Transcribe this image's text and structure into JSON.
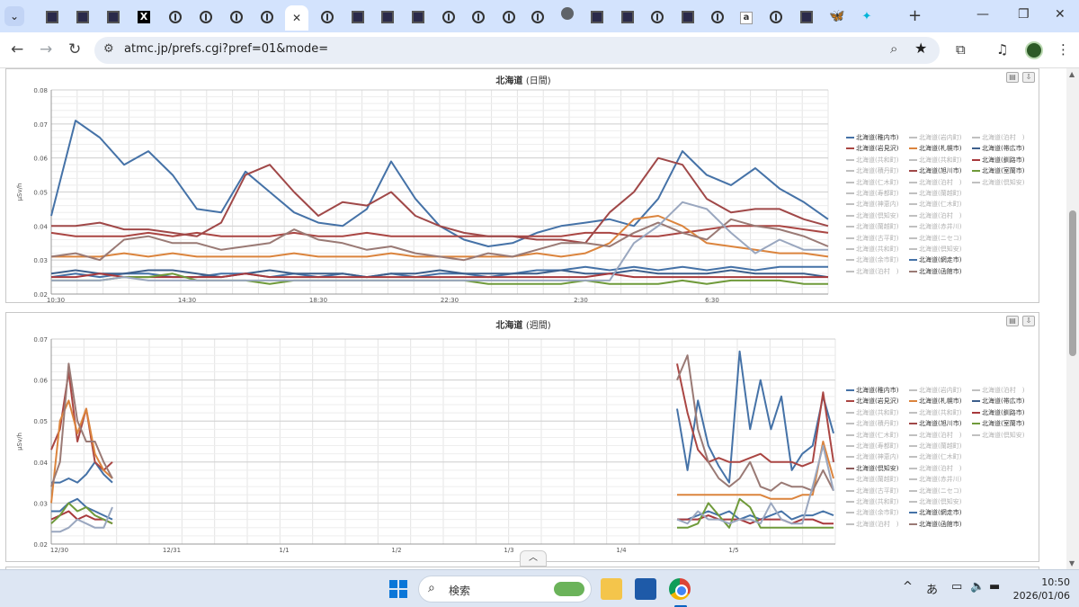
{
  "browser": {
    "url": "atmc.jp/prefs.cgi?pref=01&mode=",
    "tabs_dropdown_icon": "chevron-down-icon",
    "tabs": [
      {
        "icon": "square-site-icon"
      },
      {
        "icon": "square-site-icon"
      },
      {
        "icon": "square-site-icon"
      },
      {
        "icon": "x-icon"
      },
      {
        "icon": "ring-site-icon"
      },
      {
        "icon": "ring-site-icon"
      },
      {
        "icon": "ring-site-icon"
      },
      {
        "icon": "ring-site-icon"
      },
      {
        "icon": "close-icon",
        "active": true
      },
      {
        "icon": "ring-site-icon"
      },
      {
        "icon": "square-site-icon"
      },
      {
        "icon": "square-site-icon"
      },
      {
        "icon": "square-site-icon"
      },
      {
        "icon": "ring-site-icon"
      },
      {
        "icon": "ring-site-icon"
      },
      {
        "icon": "ring-site-icon"
      },
      {
        "icon": "ring-site-icon"
      },
      {
        "icon": "globe-icon"
      },
      {
        "icon": "square-site-icon"
      },
      {
        "icon": "square-site-icon"
      },
      {
        "icon": "ring-site-icon"
      },
      {
        "icon": "square-site-icon"
      },
      {
        "icon": "ring-site-icon"
      },
      {
        "icon": "amazon-icon"
      },
      {
        "icon": "ring-site-icon"
      },
      {
        "icon": "square-site-icon"
      },
      {
        "icon": "butterfly-icon"
      },
      {
        "icon": "sparkle-icon"
      }
    ]
  },
  "page": {
    "charts": [
      {
        "title_main": "北海道",
        "title_sub": "(日間)",
        "ylabel": "μSv/h",
        "y_ticks": [
          "0.08",
          "0.07",
          "0.06",
          "0.05",
          "0.04",
          "0.03",
          "0.02"
        ],
        "x_ticks": [
          "10:30",
          "14:30",
          "18:30",
          "22:30",
          "2:30",
          "6:30"
        ],
        "legend": [
          [
            "北海道(稚内市)",
            "北海道(岩内町)",
            "北海道(泊村　)"
          ],
          [
            "北海道(岩見沢)",
            "北海道(札幌市)",
            "北海道(帯広市)"
          ],
          [
            "北海道(共和町)",
            "北海道(共和町)",
            "北海道(釧路市)"
          ],
          [
            "北海道(積丹町)",
            "北海道(旭川市)",
            "北海道(室蘭市)"
          ],
          [
            "北海道(仁木町)",
            "北海道(泊村　)",
            "北海道(倶知安)"
          ],
          [
            "北海道(寿都町)",
            "北海道(蘭越町)"
          ],
          [
            "北海道(神恵内)",
            "北海道(仁木町)"
          ],
          [
            "北海道(倶知安)",
            "北海道(泊村　)"
          ],
          [
            "北海道(蘭越町)",
            "北海道(赤井川)"
          ],
          [
            "北海道(古平町)",
            "北海道(ニセコ)"
          ],
          [
            "北海道(共和町)",
            "北海道(倶知安)"
          ],
          [
            "北海道(余市町)",
            "北海道(網走市)"
          ],
          [
            "北海道(泊村　)",
            "北海道(函館市)"
          ]
        ]
      },
      {
        "title_main": "北海道",
        "title_sub": "(週間)",
        "ylabel": "μSv/h",
        "y_ticks": [
          "0.07",
          "0.06",
          "0.05",
          "0.04",
          "0.03",
          "0.02"
        ],
        "x_ticks": [
          "12/30",
          "12/31",
          "1/1",
          "1/2",
          "1/3",
          "1/4",
          "1/5"
        ],
        "legend": [
          [
            "北海道(稚内市)",
            "北海道(岩内町)",
            "北海道(泊村　)"
          ],
          [
            "北海道(岩見沢)",
            "北海道(札幌市)",
            "北海道(帯広市)"
          ],
          [
            "北海道(共和町)",
            "北海道(共和町)",
            "北海道(釧路市)"
          ],
          [
            "北海道(積丹町)",
            "北海道(旭川市)",
            "北海道(室蘭市)"
          ],
          [
            "北海道(仁木町)",
            "北海道(泊村　)",
            "北海道(倶知安)"
          ],
          [
            "北海道(寿都町)",
            "北海道(蘭越町)"
          ],
          [
            "北海道(神恵内)",
            "北海道(仁木町)"
          ],
          [
            "北海道(倶知安)",
            "北海道(泊村　)"
          ],
          [
            "北海道(蘭越町)",
            "北海道(赤井川)"
          ],
          [
            "北海道(古平町)",
            "北海道(ニセコ)"
          ],
          [
            "北海道(共和町)",
            "北海道(倶知安)"
          ],
          [
            "北海道(余市町)",
            "北海道(網走市)"
          ],
          [
            "北海道(泊村　)",
            "北海道(函館市)"
          ]
        ]
      }
    ],
    "print_icon": "printer-icon",
    "download_icon": "download-icon"
  },
  "legend_colors": {
    "北海道(稚内市)": "#4572a7",
    "北海道(岩内町)": "#c0c0c0",
    "北海道(泊村　)": "#c0c0c0",
    "北海道(岩見沢)": "#aa4643",
    "北海道(札幌市)": "#db843d",
    "北海道(帯広市)": "#3d5f8c",
    "北海道(共和町)": "#c0c0c0",
    "北海道(釧路市)": "#a8393c",
    "北海道(積丹町)": "#c0c0c0",
    "北海道(旭川市)": "#a04848",
    "北海道(室蘭市)": "#6f9a3a",
    "北海道(仁木町)": "#c0c0c0",
    "北海道(倶知安)": "#c0c0c0",
    "北海道(寿都町)": "#c0c0c0",
    "北海道(蘭越町)": "#c0c0c0",
    "北海道(神恵内)": "#c0c0c0",
    "北海道(赤井川)": "#c0c0c0",
    "北海道(古平町)": "#c0c0c0",
    "北海道(ニセコ)": "#c0c0c0",
    "北海道(余市町)": "#c0c0c0",
    "北海道(網走市)": "#4572a7",
    "北海道(函館市)": "#9a7a75"
  },
  "legend_active_override": {
    "1-7-0": "#8c5a5a"
  },
  "taskbar": {
    "search_label": "検索",
    "ime": "あ",
    "time": "10:50",
    "date": "2026/01/06"
  },
  "chart_data": [
    {
      "type": "line",
      "title": "北海道 (日間)",
      "ylabel": "μSv/h",
      "ylim": [
        0.02,
        0.08
      ],
      "x": [
        "10:30",
        "11:30",
        "12:30",
        "13:30",
        "14:30",
        "15:30",
        "16:30",
        "17:30",
        "18:30",
        "19:30",
        "20:30",
        "21:30",
        "22:30",
        "23:30",
        "0:30",
        "1:30",
        "2:30",
        "3:30",
        "4:30",
        "5:30",
        "6:30",
        "7:30",
        "8:30",
        "9:30"
      ],
      "series": [
        {
          "name": "北海道(稚内市)",
          "color": "#4572a7",
          "values": [
            0.043,
            0.071,
            0.066,
            0.058,
            0.062,
            0.055,
            0.045,
            0.044,
            0.056,
            0.05,
            0.044,
            0.041,
            0.04,
            0.045,
            0.059,
            0.048,
            0.04,
            0.036,
            0.034,
            0.035,
            0.038,
            0.04,
            0.041,
            0.042,
            0.04,
            0.048,
            0.062,
            0.055,
            0.052,
            0.057,
            0.051,
            0.047,
            0.042
          ]
        },
        {
          "name": "北海道(岩見沢)",
          "color": "#aa4643",
          "values": [
            0.038,
            0.037,
            0.037,
            0.037,
            0.038,
            0.037,
            0.038,
            0.037,
            0.037,
            0.037,
            0.038,
            0.037,
            0.037,
            0.038,
            0.037,
            0.037,
            0.037,
            0.037,
            0.037,
            0.037,
            0.037,
            0.037,
            0.038,
            0.038,
            0.037,
            0.037,
            0.038,
            0.039,
            0.04,
            0.04,
            0.04,
            0.039,
            0.038
          ]
        },
        {
          "name": "北海道(旭川市)",
          "color": "#a04848",
          "values": [
            0.04,
            0.04,
            0.041,
            0.039,
            0.039,
            0.038,
            0.037,
            0.041,
            0.055,
            0.058,
            0.05,
            0.043,
            0.047,
            0.046,
            0.05,
            0.043,
            0.04,
            0.038,
            0.037,
            0.037,
            0.036,
            0.036,
            0.035,
            0.044,
            0.05,
            0.06,
            0.058,
            0.048,
            0.044,
            0.045,
            0.045,
            0.042,
            0.04
          ]
        },
        {
          "name": "北海道(札幌市)",
          "color": "#db843d",
          "values": [
            0.031,
            0.031,
            0.031,
            0.032,
            0.031,
            0.032,
            0.031,
            0.031,
            0.031,
            0.031,
            0.032,
            0.031,
            0.031,
            0.031,
            0.032,
            0.031,
            0.031,
            0.031,
            0.031,
            0.031,
            0.032,
            0.031,
            0.032,
            0.035,
            0.042,
            0.043,
            0.04,
            0.035,
            0.034,
            0.033,
            0.032,
            0.032,
            0.031
          ]
        },
        {
          "name": "北海道(函館市)",
          "color": "#9a7a75",
          "values": [
            0.031,
            0.032,
            0.03,
            0.036,
            0.037,
            0.035,
            0.035,
            0.033,
            0.034,
            0.035,
            0.039,
            0.036,
            0.035,
            0.033,
            0.034,
            0.032,
            0.031,
            0.03,
            0.032,
            0.031,
            0.033,
            0.035,
            0.035,
            0.034,
            0.038,
            0.041,
            0.038,
            0.036,
            0.042,
            0.04,
            0.039,
            0.037,
            0.034
          ]
        },
        {
          "name": "北海道(網走市)",
          "color": "#4572a7",
          "values": [
            0.025,
            0.026,
            0.025,
            0.026,
            0.026,
            0.025,
            0.025,
            0.026,
            0.026,
            0.025,
            0.026,
            0.025,
            0.026,
            0.025,
            0.026,
            0.025,
            0.026,
            0.026,
            0.025,
            0.026,
            0.027,
            0.027,
            0.028,
            0.027,
            0.028,
            0.027,
            0.028,
            0.027,
            0.028,
            0.027,
            0.028,
            0.028,
            0.028
          ]
        },
        {
          "name": "北海道(帯広市)",
          "color": "#3d5f8c",
          "values": [
            0.026,
            0.027,
            0.026,
            0.026,
            0.027,
            0.027,
            0.026,
            0.025,
            0.026,
            0.027,
            0.026,
            0.026,
            0.026,
            0.025,
            0.026,
            0.026,
            0.027,
            0.026,
            0.026,
            0.026,
            0.026,
            0.027,
            0.026,
            0.026,
            0.027,
            0.026,
            0.026,
            0.026,
            0.027,
            0.026,
            0.026,
            0.026,
            0.025
          ]
        },
        {
          "name": "北海道(釧路市)",
          "color": "#a8393c",
          "values": [
            0.025,
            0.025,
            0.026,
            0.025,
            0.025,
            0.025,
            0.025,
            0.025,
            0.026,
            0.025,
            0.025,
            0.025,
            0.025,
            0.025,
            0.025,
            0.025,
            0.025,
            0.025,
            0.025,
            0.025,
            0.025,
            0.025,
            0.025,
            0.026,
            0.025,
            0.025,
            0.025,
            0.025,
            0.025,
            0.025,
            0.025,
            0.025,
            0.025
          ]
        },
        {
          "name": "北海道(室蘭市)",
          "color": "#6f9a3a",
          "values": [
            0.024,
            0.024,
            0.024,
            0.025,
            0.025,
            0.026,
            0.024,
            0.024,
            0.024,
            0.023,
            0.024,
            0.024,
            0.024,
            0.024,
            0.024,
            0.024,
            0.024,
            0.024,
            0.023,
            0.023,
            0.023,
            0.023,
            0.024,
            0.023,
            0.023,
            0.023,
            0.024,
            0.023,
            0.024,
            0.024,
            0.024,
            0.023,
            0.023
          ]
        },
        {
          "name": "北海道(寿都町)",
          "color": "#9aa7bf",
          "values": [
            0.024,
            0.024,
            0.024,
            0.025,
            0.024,
            0.024,
            0.024,
            0.024,
            0.024,
            0.024,
            0.024,
            0.024,
            0.024,
            0.024,
            0.024,
            0.024,
            0.024,
            0.024,
            0.024,
            0.024,
            0.024,
            0.024,
            0.024,
            0.024,
            0.035,
            0.04,
            0.047,
            0.045,
            0.038,
            0.032,
            0.036,
            0.033,
            0.033
          ]
        }
      ]
    },
    {
      "type": "line",
      "title": "北海道 (週間)",
      "ylabel": "μSv/h",
      "ylim": [
        0.02,
        0.07
      ],
      "x": [
        "12/30",
        "12/31",
        "1/1",
        "1/2",
        "1/3",
        "1/4",
        "1/5"
      ],
      "note_segments": "data present only near 12/30 and from late 1/4 to 1/5",
      "series": [
        {
          "name": "北海道(稚内市)",
          "color": "#4572a7",
          "segment1": [
            0.035,
            0.035,
            0.036,
            0.035,
            0.037,
            0.04,
            0.037,
            0.035
          ],
          "segment2": [
            0.053,
            0.038,
            0.055,
            0.044,
            0.039,
            0.035,
            0.067,
            0.048,
            0.06,
            0.048,
            0.056,
            0.038,
            0.042,
            0.044,
            0.056,
            0.047
          ]
        },
        {
          "name": "北海道(岩見沢)",
          "color": "#aa4643",
          "segment1": [
            0.043,
            0.048,
            0.062,
            0.045,
            0.053,
            0.04,
            0.038,
            0.04
          ],
          "segment2": [
            0.064,
            0.052,
            0.043,
            0.04,
            0.041,
            0.04,
            0.04,
            0.041,
            0.042,
            0.04,
            0.04,
            0.04,
            0.039,
            0.04,
            0.057,
            0.04
          ]
        },
        {
          "name": "北海道(札幌市)",
          "color": "#db843d",
          "segment1": [
            0.03,
            0.05,
            0.055,
            0.047,
            0.053,
            0.042,
            0.038,
            0.036
          ],
          "segment2": [
            0.032,
            0.032,
            0.032,
            0.032,
            0.032,
            0.032,
            0.032,
            0.032,
            0.032,
            0.031,
            0.031,
            0.031,
            0.032,
            0.032,
            0.045,
            0.036
          ]
        },
        {
          "name": "北海道(函館市)",
          "color": "#9a7a75",
          "segment1": [
            0.034,
            0.04,
            0.064,
            0.05,
            0.045,
            0.045,
            0.04,
            0.036
          ],
          "segment2": [
            0.06,
            0.066,
            0.048,
            0.04,
            0.036,
            0.034,
            0.036,
            0.04,
            0.034,
            0.033,
            0.035,
            0.034,
            0.034,
            0.033,
            0.038,
            0.033
          ]
        },
        {
          "name": "北海道(網走市)",
          "color": "#4572a7",
          "segment1": [
            0.028,
            0.028,
            0.03,
            0.031,
            0.029,
            0.028,
            0.027,
            0.026
          ],
          "segment2": [
            0.026,
            0.026,
            0.027,
            0.028,
            0.027,
            0.028,
            0.026,
            0.027,
            0.026,
            0.027,
            0.028,
            0.026,
            0.027,
            0.027,
            0.028,
            0.027
          ]
        },
        {
          "name": "北海道(釧路市)",
          "color": "#a8393c",
          "segment1": [
            0.026,
            0.027,
            0.028,
            0.026,
            0.027,
            0.026,
            0.026,
            0.025
          ],
          "segment2": [
            0.026,
            0.026,
            0.026,
            0.027,
            0.026,
            0.026,
            0.026,
            0.025,
            0.026,
            0.026,
            0.026,
            0.025,
            0.026,
            0.026,
            0.025,
            0.025
          ]
        },
        {
          "name": "北海道(室蘭市)",
          "color": "#6f9a3a",
          "segment1": [
            0.025,
            0.027,
            0.03,
            0.028,
            0.029,
            0.027,
            0.026,
            0.025
          ],
          "segment2": [
            0.024,
            0.024,
            0.025,
            0.03,
            0.027,
            0.024,
            0.031,
            0.029,
            0.024,
            0.024,
            0.024,
            0.024,
            0.024,
            0.024,
            0.024,
            0.024
          ]
        },
        {
          "name": "北海道(寿都町)",
          "color": "#9aa7bf",
          "segment1": [
            0.023,
            0.023,
            0.024,
            0.026,
            0.025,
            0.024,
            0.024,
            0.029
          ],
          "segment2": [
            0.026,
            0.025,
            0.028,
            0.026,
            0.026,
            0.025,
            0.026,
            0.026,
            0.025,
            0.03,
            0.026,
            0.025,
            0.025,
            0.034,
            0.044,
            0.033
          ]
        }
      ]
    }
  ]
}
